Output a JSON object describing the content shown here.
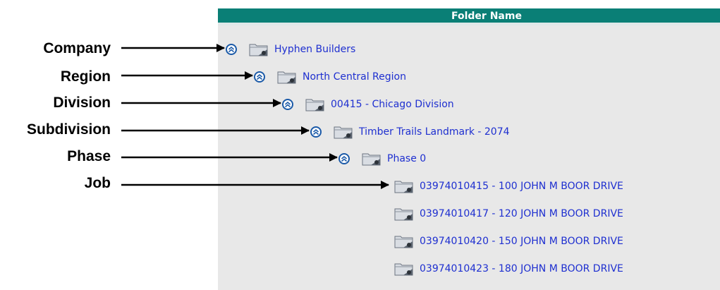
{
  "header": {
    "title": "Folder Name"
  },
  "annotations": [
    "Company",
    "Region",
    "Division",
    "Subdivision",
    "Phase",
    "Job"
  ],
  "tree": [
    {
      "label": "Hyphen Builders",
      "expander": "collapse-icon"
    },
    {
      "label": "North Central Region",
      "expander": "collapse-icon"
    },
    {
      "label": "00415 - Chicago Division",
      "expander": "collapse-icon"
    },
    {
      "label": "Timber Trails Landmark - 2074",
      "expander": "collapse-icon"
    },
    {
      "label": "Phase 0",
      "expander": "collapse-icon"
    },
    {
      "label": "03974010415 - 100 JOHN M BOOR DRIVE"
    },
    {
      "label": "03974010417 - 120 JOHN M BOOR DRIVE"
    },
    {
      "label": "03974010420 - 150 JOHN M BOOR DRIVE"
    },
    {
      "label": "03974010423 - 180 JOHN M BOOR DRIVE"
    }
  ],
  "colors": {
    "header_bg": "#0a7f76",
    "panel_bg": "#e8e8e8",
    "link": "#1e2fd0",
    "expander": "#1b5aa8"
  },
  "icons": {
    "node": "folder-icon",
    "expander": "double-chevron-up-icon",
    "pointer": "arrow-right-icon"
  }
}
